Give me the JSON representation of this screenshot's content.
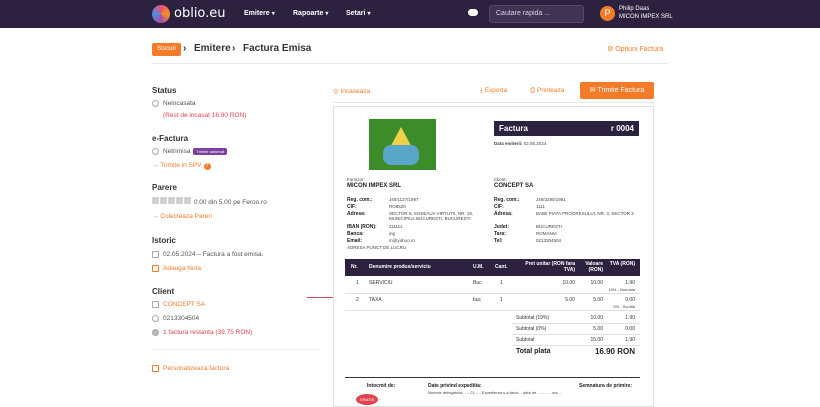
{
  "nav": {
    "logo_text": "oblio.eu",
    "menu": [
      "Emitere",
      "Rapoarte",
      "Setari"
    ],
    "search_placeholder": "Cautare rapida ...",
    "user_initial": "P",
    "user_name": "Philip Daas",
    "user_company": "MICON IMPEX SRL"
  },
  "breadcrumb": {
    "tag": "Stocuri",
    "sep": "›",
    "items": [
      "Emitere",
      "Factura Emisa"
    ],
    "options_label": "Optiuni Factura"
  },
  "sidebar": {
    "status": {
      "title": "Status",
      "value": "Neincasata",
      "remaining": "(Rest de incasat 16.90 RON)"
    },
    "efactura": {
      "title": "e-Factura",
      "value": "Netrimisa",
      "badge": "Trimite automat",
      "action": "Trimite in SPV"
    },
    "parere": {
      "title": "Parere",
      "rating_text": "0.00 din 5.00 pe Feroo.ro",
      "action": "Colecteaza Pareri"
    },
    "istoric": {
      "title": "Istoric",
      "entry": "02.05.2024 – Factura a fost emisa.",
      "action": "Adauga Nota"
    },
    "client": {
      "title": "Client",
      "name": "CONCEPT SA",
      "phone": "0213304504",
      "outstanding": "1 factura restanta (39.75 RON)"
    },
    "personalize": "Personalizeaza factura"
  },
  "actions": {
    "incaseaza": "Incaseaza",
    "exporta": "Exporta",
    "printeaza": "Printeaza",
    "trimite": "Trimite Factura"
  },
  "invoice": {
    "title": "Factura",
    "number": "r 0004",
    "date_label": "Data emiterii:",
    "date": "02.05.2024",
    "supplier": {
      "label": "Furnizor:",
      "name": "MICON IMPEX SRL",
      "fields": [
        [
          "Reg. com.:",
          "J40/1127/1997"
        ],
        [
          "CIF:",
          "RO8520"
        ],
        [
          "Adresa:",
          "SECTOR 6, SOSEAUA VIRTUTII, NR. 19, MUNICIPIUL BUCURESTI, BUCURESTI"
        ],
        [
          "IBAN (RON):",
          "111111"
        ],
        [
          "Banca:",
          "ing"
        ],
        [
          "Email:",
          "m@yahoo.ro"
        ]
      ],
      "extra": "ADRESA PUNCT DE LUCRU"
    },
    "client": {
      "label": "Client:",
      "name": "CONCEPT SA",
      "fields": [
        [
          "Reg. com.:",
          "J40/3290/1991"
        ],
        [
          "CIF:",
          "1111"
        ],
        [
          "Adresa:",
          "BABII PIATA PROGRESULUI, NR. 3, SECTOR 2"
        ],
        [
          "Judet:",
          "BUCURESTI"
        ],
        [
          "Tara:",
          "ROMANIA"
        ],
        [
          "Tel:",
          "0213304504"
        ]
      ]
    },
    "table_headers": [
      "Nr.",
      "Denumire produs/serviciu",
      "U.M.",
      "Cant.",
      "Pret unitar (RON fara TVA)",
      "Valoare (RON)",
      "TVA (RON)"
    ],
    "rows": [
      {
        "nr": "1",
        "name": "SERVICIU",
        "um": "Buc",
        "qty": "1",
        "price": "10.00",
        "value": "10.00",
        "vat": "1.90",
        "note": "19% - Normala"
      },
      {
        "nr": "2",
        "name": "TAXA",
        "um": "buc",
        "qty": "1",
        "price": "5.00",
        "value": "5.00",
        "vat": "0.00",
        "note": "0% - Scutita"
      }
    ],
    "subtotals": [
      {
        "label": "Subtotal (19%)",
        "value": "10.00",
        "vat": "1.90"
      },
      {
        "label": "Subtotal (0%)",
        "value": "5.00",
        "vat": "0.00"
      },
      {
        "label": "Subtotal",
        "value": "15.00",
        "vat": "1.90"
      }
    ],
    "total_label": "Total plata",
    "total_value": "16.90 RON",
    "footer": {
      "intocmit": "Intocmit de:",
      "expeditie": "Date privind expeditia:",
      "delegat": "Numele delegatului: ..., CI: ..., Expedierea s-a facut... data de ..........., ora ...",
      "semnatura": "Semnatura de primire:",
      "cnp": "CNP: -",
      "stamp": "GRATIS"
    }
  }
}
